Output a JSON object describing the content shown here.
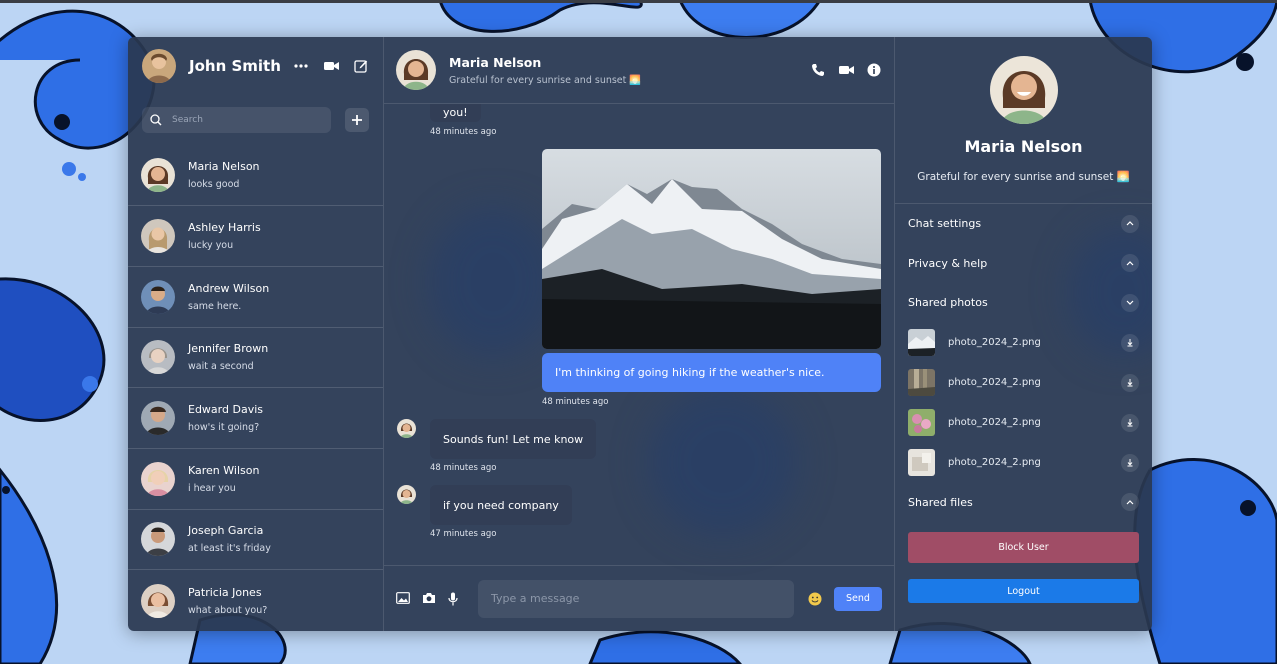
{
  "colors": {
    "accent": "#4f82f7",
    "block": "#a04d66",
    "logout": "#1b7ae8",
    "panel": "#2a3850"
  },
  "current_user": {
    "name": "John Smith"
  },
  "search": {
    "placeholder": "Search"
  },
  "contacts": [
    {
      "name": "Maria Nelson",
      "last": "looks good"
    },
    {
      "name": "Ashley Harris",
      "last": "lucky you"
    },
    {
      "name": "Andrew Wilson",
      "last": "same here."
    },
    {
      "name": "Jennifer Brown",
      "last": "wait a second"
    },
    {
      "name": "Edward Davis",
      "last": "how's it going?"
    },
    {
      "name": "Karen Wilson",
      "last": "i hear you"
    },
    {
      "name": "Joseph Garcia",
      "last": "at least it's friday"
    },
    {
      "name": "Patricia Jones",
      "last": "what about you?"
    }
  ],
  "chat": {
    "name": "Maria Nelson",
    "status": "Grateful for every sunrise and sunset 🌅",
    "messages": [
      {
        "from": "them",
        "text": "you!",
        "time": "48 minutes ago"
      },
      {
        "from": "me",
        "type": "image",
        "text": "I'm thinking of going hiking if the weather's nice.",
        "time": "48 minutes ago"
      },
      {
        "from": "them",
        "text": "Sounds fun! Let me know",
        "time": "48 minutes ago"
      },
      {
        "from": "them",
        "text": "if you need company",
        "time": "47 minutes ago"
      }
    ]
  },
  "composer": {
    "placeholder": "Type a message",
    "send_label": "Send"
  },
  "details": {
    "name": "Maria Nelson",
    "status": "Grateful for every sunrise and sunset 🌅",
    "sections": {
      "chat_settings": "Chat settings",
      "privacy": "Privacy & help",
      "shared_photos": "Shared photos",
      "shared_files": "Shared files"
    },
    "photos": [
      {
        "name": "photo_2024_2.png"
      },
      {
        "name": "photo_2024_2.png"
      },
      {
        "name": "photo_2024_2.png"
      },
      {
        "name": "photo_2024_2.png"
      }
    ],
    "block_label": "Block User",
    "logout_label": "Logout"
  }
}
